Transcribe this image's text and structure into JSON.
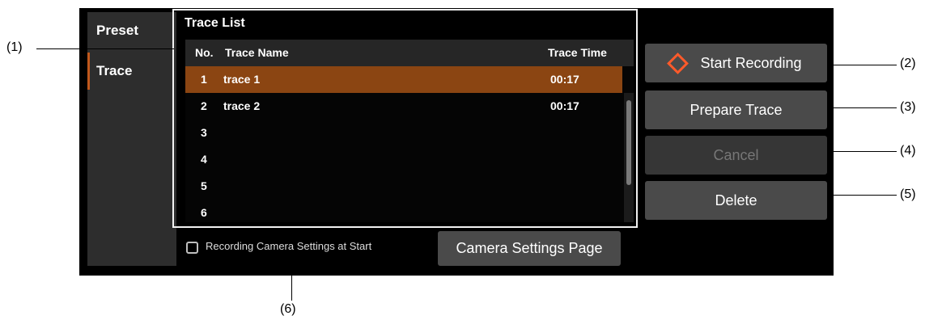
{
  "sidebar": {
    "items": [
      {
        "label": "Preset"
      },
      {
        "label": "Trace"
      }
    ]
  },
  "trace_list": {
    "title": "Trace List",
    "headers": {
      "no": "No.",
      "name": "Trace Name",
      "time": "Trace Time"
    },
    "rows": [
      {
        "no": "1",
        "name": "trace 1",
        "time": "00:17",
        "selected": true
      },
      {
        "no": "2",
        "name": "trace 2",
        "time": "00:17"
      },
      {
        "no": "3",
        "name": "",
        "time": ""
      },
      {
        "no": "4",
        "name": "",
        "time": ""
      },
      {
        "no": "5",
        "name": "",
        "time": ""
      },
      {
        "no": "6",
        "name": "",
        "time": ""
      }
    ]
  },
  "buttons": {
    "start_recording": "Start Recording",
    "prepare_trace": "Prepare Trace",
    "cancel": "Cancel",
    "delete": "Delete",
    "camera_settings": "Camera Settings Page"
  },
  "checkbox": {
    "label": "Recording Camera Settings at Start",
    "checked": false
  },
  "callouts": {
    "one": "(1)",
    "two": "(2)",
    "three": "(3)",
    "four": "(4)",
    "five": "(5)",
    "six": "(6)"
  },
  "colors": {
    "selected_row": "#8b4512",
    "active_tab_indicator": "#c0581c",
    "record_icon": "#ff5a2a"
  }
}
